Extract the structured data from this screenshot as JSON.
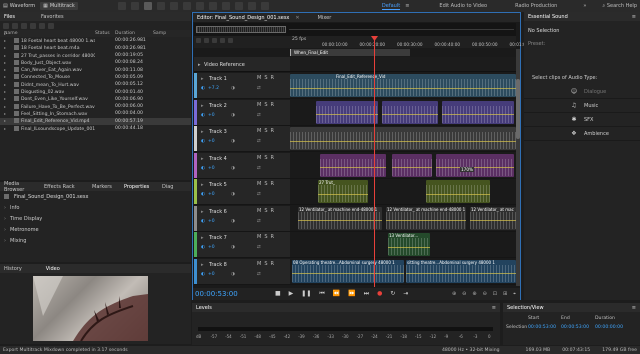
{
  "toolbar": {
    "waveform_label": "Waveform",
    "multitrack_label": "Multitrack",
    "workspaces": [
      "Default",
      "Edit Audio to Video",
      "Radio Production"
    ],
    "active_workspace": "Default",
    "search_placeholder": "Search Help"
  },
  "files_panel": {
    "tabs": [
      "Files",
      "Favorites"
    ],
    "columns": [
      "Name",
      "Status",
      "Duration",
      "Samp"
    ],
    "rows": [
      {
        "name": "18 Foetal heart beat 48000 1.wav",
        "duration": "00:00:26.981"
      },
      {
        "name": "18 Foetal heart beat.m4a",
        "duration": "00:00:26.981"
      },
      {
        "name": "27 Trut_passes in corridor 48000 1.wav",
        "duration": "00:00:19:05"
      },
      {
        "name": "Body_Just_Object.wav",
        "duration": "00:00:08.24"
      },
      {
        "name": "Can_Never_Eat_Again.wav",
        "duration": "00:00:11.08"
      },
      {
        "name": "Connected_To_Mouse",
        "duration": "00:00:05.09"
      },
      {
        "name": "Didnt_mean_To_Hurt.wav",
        "duration": "00:00:05.12"
      },
      {
        "name": "Disgusting_02.wav",
        "duration": "00:00:01.40"
      },
      {
        "name": "Dont_Even_Like_Yourself.wav",
        "duration": "00:00:06.90"
      },
      {
        "name": "Failure_Have_To_Be_Perfect.wav",
        "duration": "00:00:06.00"
      },
      {
        "name": "Feel_Sitting_In_Stomach.wav",
        "duration": "00:00:04.00"
      },
      {
        "name": "Final_Edit_Reference_Vid.mp4",
        "duration": "00:00:57.19"
      },
      {
        "name": "Final_ILsoundscope_Update_001.wav",
        "duration": "00:00:44.18"
      }
    ]
  },
  "mid_panel": {
    "tabs": [
      "Media Browser",
      "Effects Rack",
      "Markers",
      "Properties",
      "Diag"
    ],
    "active_tab": "Properties",
    "file": "Final_Sound_Design_001.sesx",
    "sections": [
      "Info",
      "Time Display",
      "Metronome",
      "Mixing"
    ]
  },
  "bottom_left": {
    "tabs": [
      "History",
      "Video"
    ],
    "active_tab": "Video"
  },
  "editor": {
    "tab": "Editor: Final_Sound_Design_001.sesx",
    "mixer_tab": "Mixer",
    "fps": "25 fps",
    "ruler": [
      "00:00:10:00",
      "00:00:20:00",
      "00:00:30:00",
      "00:00:40:00",
      "00:00:50:00",
      "00:01:00:00"
    ],
    "video_track": "Video Reference",
    "video_marker": "When_Final_Edit",
    "tracks": [
      {
        "name": "Track 1",
        "vol": "+7.2",
        "color": "#5aa6d6"
      },
      {
        "name": "Track 2",
        "vol": "+0",
        "color": "#7a6bd8"
      },
      {
        "name": "Track 3",
        "vol": "+0",
        "color": "#cfcfcf"
      },
      {
        "name": "Track 4",
        "vol": "+0",
        "color": "#b063c0"
      },
      {
        "name": "Track 5",
        "vol": "+0",
        "color": "#9ac04a"
      },
      {
        "name": "Track 6",
        "vol": "+0",
        "color": "#8c8c8c"
      },
      {
        "name": "Track 7",
        "vol": "+0",
        "color": "#4cae5a"
      },
      {
        "name": "Track 8",
        "vol": "+0",
        "color": "#3e8fd0"
      }
    ],
    "clip_labels": {
      "track1": "Final_Edit_Reference_Vid",
      "track5": "27 Trut_",
      "track6_a": "12 Ventilator_ at machine end-48000 1",
      "track6_b": "12 Ventilator_ at machine end-48000 1",
      "track6_c": "12 Ventilator_ at mac",
      "track7": "13 Ventilator...",
      "track8_a": "08 Operating theatre...Abdominal surgery 48000 1",
      "track8_b": "sitting theatre...Abdominal surgery 48000 1",
      "dbval": "170%"
    },
    "timecode": "00:00:53:00"
  },
  "essential_sound": {
    "title": "Essential Sound",
    "selection": "No Selection",
    "preset_label": "Preset:",
    "prompt": "Select clips of Audio Type:",
    "types": [
      {
        "label": "Dialogue",
        "icon": "dialogue-icon",
        "glyph": "☺"
      },
      {
        "label": "Music",
        "icon": "music-icon",
        "glyph": "♫"
      },
      {
        "label": "SFX",
        "icon": "sfx-icon",
        "glyph": "✱"
      },
      {
        "label": "Ambience",
        "icon": "ambience-icon",
        "glyph": "❖"
      }
    ]
  },
  "levels": {
    "title": "Levels",
    "scale": [
      "dB",
      "-57",
      "-54",
      "-51",
      "-48",
      "-45",
      "-42",
      "-39",
      "-36",
      "-33",
      "-30",
      "-27",
      "-24",
      "-21",
      "-18",
      "-15",
      "-12",
      "-9",
      "-6",
      "-3",
      "0"
    ]
  },
  "selection_view": {
    "title": "Selection/View",
    "headers": [
      "Start",
      "End",
      "Duration"
    ],
    "row_label": "Selection",
    "start": "00:00:53:00",
    "end": "00:00:53:00",
    "duration": "00:00:00:00"
  },
  "status_bar": {
    "message": "Export Multitrack Mixdown completed in 3.17 seconds",
    "format": "48000 Hz • 32-bit Mixing",
    "size": "169.03 MB",
    "duration": "00:07:43:15",
    "free": "179.49 GB free"
  }
}
